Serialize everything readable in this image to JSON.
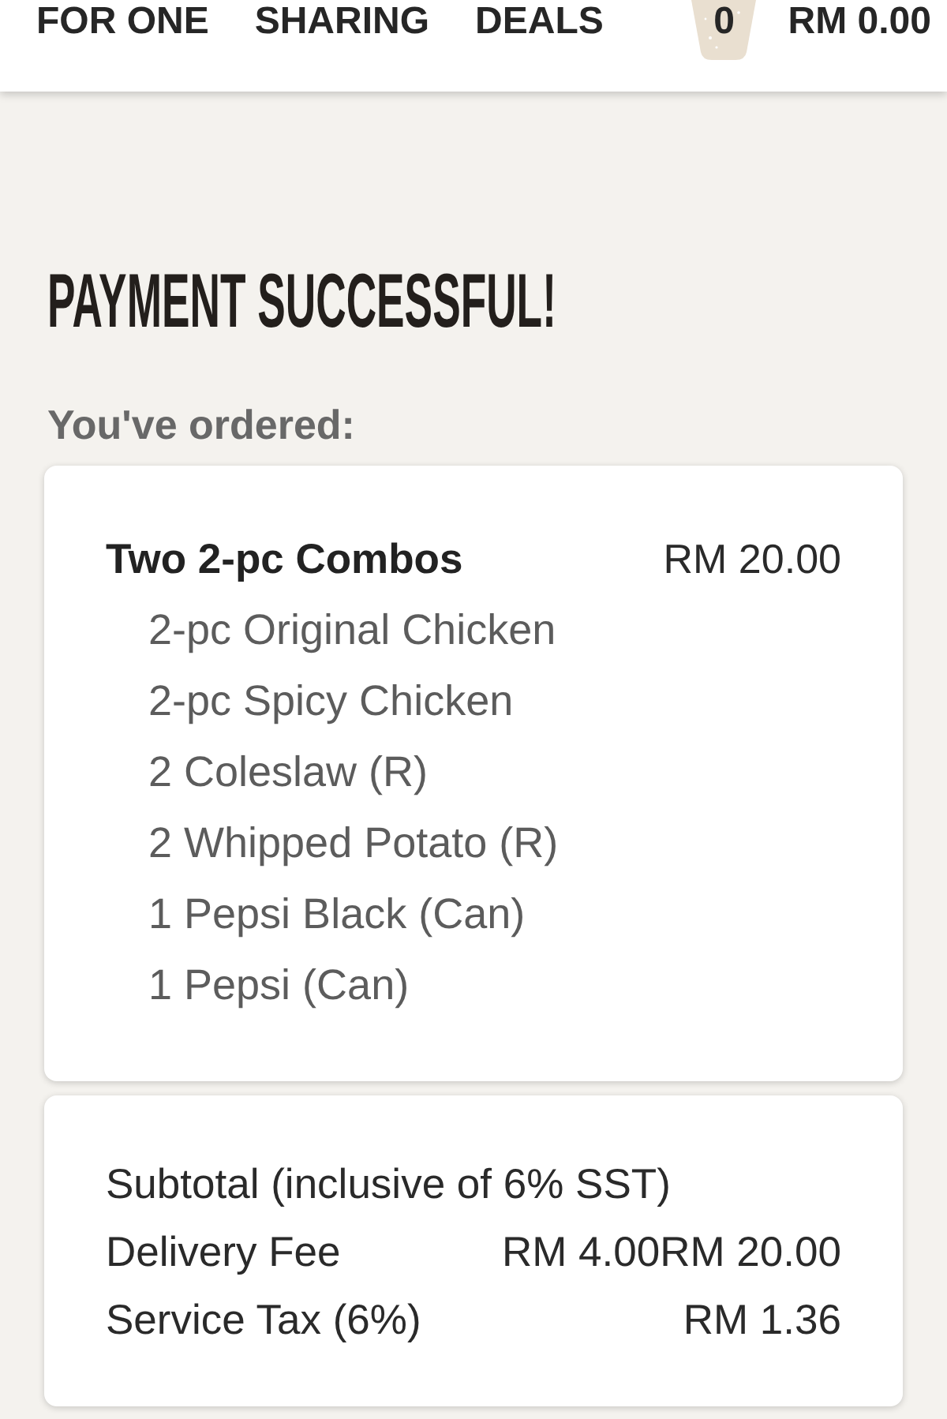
{
  "header": {
    "nav": [
      "FOR ONE",
      "SHARING",
      "DEALS"
    ],
    "cart": {
      "count": "0",
      "total": "RM 0.00"
    }
  },
  "title": "PAYMENT SUCCESSFUL!",
  "ordered_label": "You've ordered:",
  "order": {
    "items": [
      {
        "name": "Two 2-pc Combos",
        "price": "RM 20.00",
        "components": [
          "2-pc Original Chicken",
          "2-pc Spicy Chicken",
          "2 Coleslaw (R)",
          "2 Whipped Potato (R)",
          "1 Pepsi Black (Can)",
          "1 Pepsi (Can)"
        ]
      }
    ]
  },
  "summary": {
    "rows": [
      {
        "label": "Subtotal (inclusive of 6% SST)"
      },
      {
        "label": "Delivery Fee",
        "value": "RM 4.00RM 20.00"
      },
      {
        "label": "Service Tax (6%)",
        "value": "RM 1.36"
      }
    ]
  }
}
